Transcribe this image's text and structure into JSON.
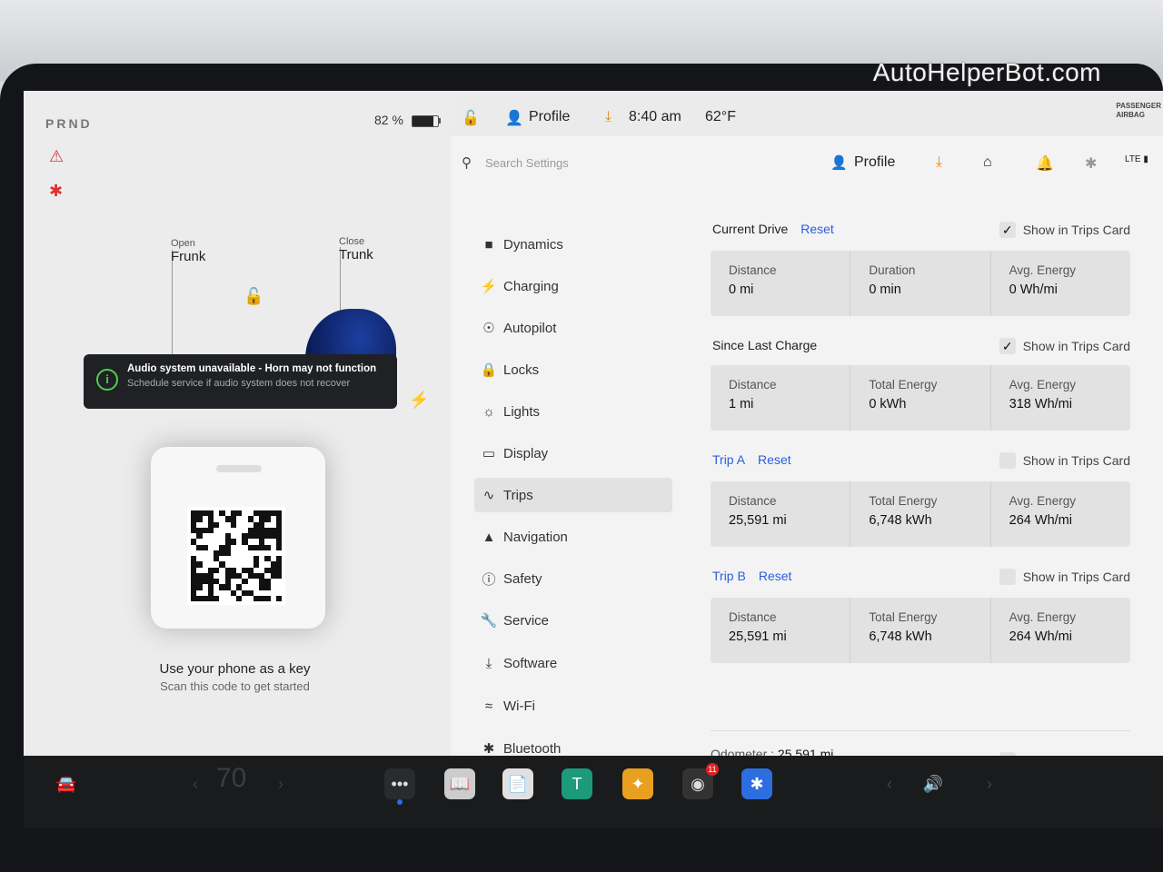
{
  "watermark": "AutoHelperBot.com",
  "car": {
    "gear": "PRND",
    "battery_pct": "82 %",
    "battery_level": 0.82,
    "frunk_small": "Open",
    "frunk_big": "Frunk",
    "trunk_small": "Close",
    "trunk_big": "Trunk",
    "alert_title": "Audio system unavailable - Horn may not function",
    "alert_sub": "Schedule service if audio system does not recover",
    "phone_title": "Use your phone as a key",
    "phone_sub": "Scan this code to get started"
  },
  "statusbar": {
    "profile": "Profile",
    "time": "8:40 am",
    "temp": "62°F",
    "airbag_line1": "PASSENGER",
    "airbag_line2": "AIRBAG"
  },
  "menu": {
    "search_placeholder": "Search Settings",
    "items": [
      {
        "label": "Dynamics",
        "icon": "car-icon"
      },
      {
        "label": "Charging",
        "icon": "bolt-icon"
      },
      {
        "label": "Autopilot",
        "icon": "steering-wheel-icon"
      },
      {
        "label": "Locks",
        "icon": "lock-icon"
      },
      {
        "label": "Lights",
        "icon": "light-icon"
      },
      {
        "label": "Display",
        "icon": "display-icon"
      },
      {
        "label": "Trips",
        "icon": "trips-icon"
      },
      {
        "label": "Navigation",
        "icon": "navigation-icon"
      },
      {
        "label": "Safety",
        "icon": "safety-icon"
      },
      {
        "label": "Service",
        "icon": "wrench-icon"
      },
      {
        "label": "Software",
        "icon": "download-icon"
      },
      {
        "label": "Wi-Fi",
        "icon": "wifi-icon"
      },
      {
        "label": "Bluetooth",
        "icon": "bluetooth-icon"
      }
    ],
    "active": "Trips"
  },
  "topbar": {
    "profile": "Profile",
    "signal": "LTE"
  },
  "trips": {
    "show_label": "Show in Trips Card",
    "reset_label": "Reset",
    "current": {
      "title": "Current Drive",
      "checked": true,
      "c1_label": "Distance",
      "c1_value": "0  mi",
      "c2_label": "Duration",
      "c2_value": "0  min",
      "c3_label": "Avg. Energy",
      "c3_value": "0  Wh/mi"
    },
    "since_charge": {
      "title": "Since Last Charge",
      "checked": true,
      "c1_label": "Distance",
      "c1_value": "1  mi",
      "c2_label": "Total Energy",
      "c2_value": "0  kWh",
      "c3_label": "Avg. Energy",
      "c3_value": "318  Wh/mi"
    },
    "trip_a": {
      "title": "Trip A",
      "checked": false,
      "c1_label": "Distance",
      "c1_value": "25,591  mi",
      "c2_label": "Total Energy",
      "c2_value": "6,748  kWh",
      "c3_label": "Avg. Energy",
      "c3_value": "264  Wh/mi"
    },
    "trip_b": {
      "title": "Trip B",
      "checked": false,
      "c1_label": "Distance",
      "c1_value": "25,591  mi",
      "c2_label": "Total Energy",
      "c2_value": "6,748  kWh",
      "c3_label": "Avg. Energy",
      "c3_value": "264  Wh/mi"
    },
    "odometer_label": "Odometer  :",
    "odometer_value": "25,591  mi",
    "odometer_checked": true
  },
  "dock": {
    "temp": "70",
    "badge": "11",
    "accent": "#2c6de0"
  }
}
